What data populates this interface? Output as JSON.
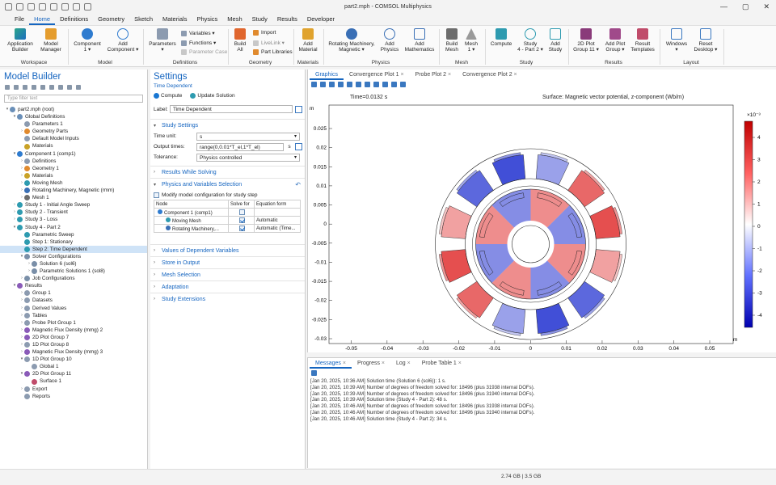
{
  "window": {
    "title": "part2.mph - COMSOL Multiphysics"
  },
  "menu": [
    "File",
    "Home",
    "Definitions",
    "Geometry",
    "Sketch",
    "Materials",
    "Physics",
    "Mesh",
    "Study",
    "Results",
    "Developer"
  ],
  "ribbon": {
    "app_builder": "Application\nBuilder",
    "model_manager": "Model\nManager",
    "component": "Component\n1 ▾",
    "add_component": "Add\nComponent ▾",
    "parameters": "Parameters\n▾",
    "variables": "Variables ▾",
    "functions": "Functions ▾",
    "parameter_case": "Parameter Case",
    "build_all": "Build\nAll",
    "import": "Import",
    "livelink": "LiveLink ▾",
    "part_libraries": "Part Libraries",
    "add_material": "Add\nMaterial",
    "rotating_machinery": "Rotating Machinery,\nMagnetic ▾",
    "add_physics": "Add\nPhysics",
    "add_mathematics": "Add\nMathematics",
    "build_mesh": "Build\nMesh",
    "mesh1": "Mesh\n1 ▾",
    "compute": "Compute",
    "study4": "Study\n4 - Part 2 ▾",
    "add_study": "Add\nStudy",
    "plot_group": "2D Plot\nGroup 11 ▾",
    "add_plot_group": "Add Plot\nGroup ▾",
    "result_templates": "Result\nTemplates",
    "windows": "Windows\n▾",
    "reset_desktop": "Reset\nDesktop ▾",
    "groups": {
      "workspace": "Workspace",
      "model": "Model",
      "definitions": "Definitions",
      "geometry": "Geometry",
      "materials": "Materials",
      "physics": "Physics",
      "mesh": "Mesh",
      "study": "Study",
      "results": "Results",
      "layout": "Layout"
    }
  },
  "model_builder": {
    "title": "Model Builder",
    "filter_placeholder": "Type filter text",
    "tree": [
      {
        "label": "part2.mph (root)",
        "level": 0,
        "arrow": "▾",
        "color": "#6a8fb8"
      },
      {
        "label": "Global Definitions",
        "level": 1,
        "arrow": "▾",
        "color": "#6a8fb8"
      },
      {
        "label": "Parameters 1",
        "level": 2,
        "arrow": "",
        "color": "#8c9bb0"
      },
      {
        "label": "Geometry Parts",
        "level": 2,
        "arrow": "›",
        "color": "#e08a2e"
      },
      {
        "label": "Default Model Inputs",
        "level": 2,
        "arrow": "",
        "color": "#8c9bb0"
      },
      {
        "label": "Materials",
        "level": 2,
        "arrow": "",
        "color": "#c9a227"
      },
      {
        "label": "Component 1 (comp1)",
        "level": 1,
        "arrow": "▾",
        "color": "#2e7bcf"
      },
      {
        "label": "Definitions",
        "level": 2,
        "arrow": "›",
        "color": "#8c9bb0"
      },
      {
        "label": "Geometry 1",
        "level": 2,
        "arrow": "›",
        "color": "#e08a2e"
      },
      {
        "label": "Materials",
        "level": 2,
        "arrow": "›",
        "color": "#c9a227"
      },
      {
        "label": "Moving Mesh",
        "level": 2,
        "arrow": "›",
        "color": "#2e9bb0"
      },
      {
        "label": "Rotating Machinery, Magnetic (rmm)",
        "level": 2,
        "arrow": "›",
        "color": "#3a6fb5"
      },
      {
        "label": "Mesh 1",
        "level": 2,
        "arrow": "›",
        "color": "#6d6d6d"
      },
      {
        "label": "Study 1 - Initial Angle Sweep",
        "level": 1,
        "arrow": "›",
        "color": "#2e9bb0"
      },
      {
        "label": "Study 2 - Transient",
        "level": 1,
        "arrow": "›",
        "color": "#2e9bb0"
      },
      {
        "label": "Study 3 - Loss",
        "level": 1,
        "arrow": "›",
        "color": "#2e9bb0"
      },
      {
        "label": "Study 4 - Part 2",
        "level": 1,
        "arrow": "▾",
        "color": "#2e9bb0"
      },
      {
        "label": "Parametric Sweep",
        "level": 2,
        "arrow": "",
        "color": "#2e9bb0"
      },
      {
        "label": "Step 1: Stationary",
        "level": 2,
        "arrow": "",
        "color": "#2e9bb0"
      },
      {
        "label": "Step 2: Time Dependent",
        "level": 2,
        "arrow": "",
        "color": "#2e9bb0",
        "selected": true
      },
      {
        "label": "Solver Configurations",
        "level": 2,
        "arrow": "▾",
        "color": "#7a8fa8"
      },
      {
        "label": "Solution 6 (sol6)",
        "level": 3,
        "arrow": "›",
        "color": "#7a8fa8"
      },
      {
        "label": "Parametric Solutions 1 (sol8)",
        "level": 3,
        "arrow": "›",
        "color": "#7a8fa8"
      },
      {
        "label": "Job Configurations",
        "level": 2,
        "arrow": "›",
        "color": "#7a8fa8"
      },
      {
        "label": "Results",
        "level": 1,
        "arrow": "▾",
        "color": "#8a5bb8"
      },
      {
        "label": "Group 1",
        "level": 2,
        "arrow": "›",
        "color": "#8c9bb0"
      },
      {
        "label": "Datasets",
        "level": 2,
        "arrow": "›",
        "color": "#8c9bb0"
      },
      {
        "label": "Derived Values",
        "level": 2,
        "arrow": "›",
        "color": "#8c9bb0"
      },
      {
        "label": "Tables",
        "level": 2,
        "arrow": "›",
        "color": "#8c9bb0"
      },
      {
        "label": "Probe Plot Group 1",
        "level": 2,
        "arrow": "›",
        "color": "#8c9bb0"
      },
      {
        "label": "Magnetic Flux Density (mmg) 2",
        "level": 2,
        "arrow": "›",
        "color": "#8a5bb8"
      },
      {
        "label": "2D Plot Group 7",
        "level": 2,
        "arrow": "›",
        "color": "#8a5bb8"
      },
      {
        "label": "1D Plot Group 8",
        "level": 2,
        "arrow": "›",
        "color": "#8c9bb0"
      },
      {
        "label": "Magnetic Flux Density (mmg) 3",
        "level": 2,
        "arrow": "›",
        "color": "#8a5bb8"
      },
      {
        "label": "1D Plot Group 10",
        "level": 2,
        "arrow": "▾",
        "color": "#8c9bb0"
      },
      {
        "label": "Global 1",
        "level": 3,
        "arrow": "",
        "color": "#8c9bb0"
      },
      {
        "label": "2D Plot Group 11",
        "level": 2,
        "arrow": "▾",
        "color": "#8a5bb8"
      },
      {
        "label": "Surface 1",
        "level": 3,
        "arrow": "",
        "color": "#c04c6a"
      },
      {
        "label": "Export",
        "level": 2,
        "arrow": "›",
        "color": "#8c9bb0"
      },
      {
        "label": "Reports",
        "level": 2,
        "arrow": "",
        "color": "#8c9bb0"
      }
    ]
  },
  "settings": {
    "title": "Settings",
    "subtitle": "Time Dependent",
    "compute": "Compute",
    "update_solution": "Update Solution",
    "label_caption": "Label:",
    "label_value": "Time Dependent",
    "study_settings": "Study Settings",
    "time_unit_caption": "Time unit:",
    "time_unit": "s",
    "output_times_caption": "Output times:",
    "output_times": "range(0,0.01*T_el,1*T_el)",
    "output_unit": "s",
    "tolerance_caption": "Tolerance:",
    "tolerance": "Physics controlled",
    "results_while_solving": "Results While Solving",
    "physics_selection": "Physics and Variables Selection",
    "modify_config": "Modify model configuration for study step",
    "table_headers": [
      "Node",
      "Solve for",
      "Equation form"
    ],
    "table_rows": [
      {
        "node": "Component 1 (comp1)",
        "solve": false,
        "eq": ""
      },
      {
        "node": "Moving Mesh",
        "solve": true,
        "eq": "Automatic"
      },
      {
        "node": "Rotating Machinery,...",
        "solve": true,
        "eq": "Automatic (Time..."
      }
    ],
    "sections": [
      "Values of Dependent Variables",
      "Store in Output",
      "Mesh Selection",
      "Adaptation",
      "Study Extensions"
    ]
  },
  "graphics": {
    "tabs": [
      "Graphics",
      "Convergence Plot 1",
      "Probe Plot 2",
      "Convergence Plot 2"
    ],
    "time_label": "Time=0.0132 s",
    "plot_title": "Surface: Magnetic vector potential, z-component (Wb/m)",
    "axis_unit": "m",
    "x_ticks": [
      "-0.05",
      "-0.04",
      "-0.03",
      "-0.02",
      "-0.01",
      "0",
      "0.01",
      "0.02",
      "0.03",
      "0.04",
      "0.05"
    ],
    "y_ticks": [
      "0.025",
      "0.02",
      "0.015",
      "0.01",
      "0.005",
      "0",
      "-0.005",
      "-0.01",
      "-0.015",
      "-0.02",
      "-0.025",
      "-0.03"
    ],
    "colorbar_exp": "×10⁻³",
    "colorbar_ticks": [
      "4",
      "3",
      "2",
      "1",
      "0",
      "-1",
      "-2",
      "-3",
      "-4"
    ],
    "colors": {
      "positive": "#e03030",
      "negative": "#2030d0",
      "neutral": "#ffffff"
    }
  },
  "messages": {
    "tabs": [
      "Messages",
      "Progress",
      "Log",
      "Probe Table 1"
    ],
    "lines": [
      "[Jan 20, 2025, 10:36 AM] Solution time (Solution 6 (sol6)): 1 s.",
      "[Jan 20, 2025, 10:39 AM] Number of degrees of freedom solved for: 18496 (plus 31938 internal DOFs).",
      "[Jan 20, 2025, 10:39 AM] Number of degrees of freedom solved for: 18496 (plus 31940 internal DOFs).",
      "[Jan 20, 2025, 10:39 AM] Solution time (Study 4 - Part 2): 48 s.",
      "[Jan 20, 2025, 10:46 AM] Number of degrees of freedom solved for: 18496 (plus 31938 internal DOFs).",
      "[Jan 20, 2025, 10:46 AM] Number of degrees of freedom solved for: 18496 (plus 31940 internal DOFs).",
      "[Jan 20, 2025, 10:46 AM] Solution time (Study 4 - Part 2): 34 s."
    ]
  },
  "status": {
    "memory": "2.74 GB | 3.5 GB"
  }
}
